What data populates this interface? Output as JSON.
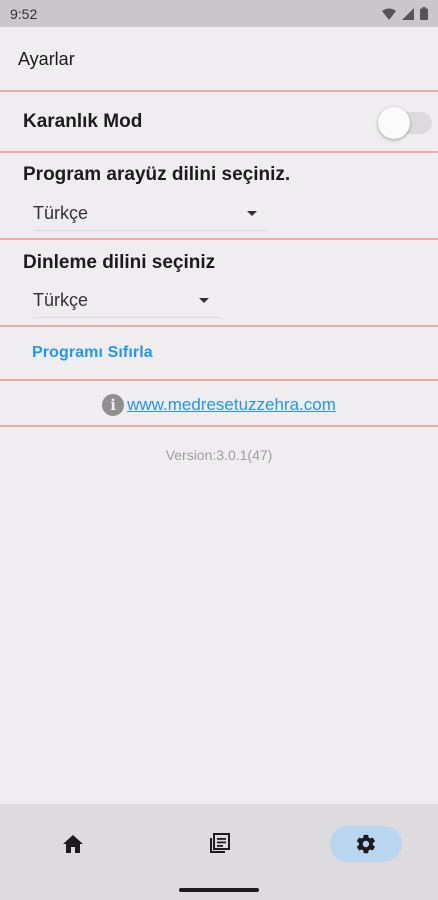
{
  "status_bar": {
    "time": "9:52"
  },
  "app_bar": {
    "title": "Ayarlar"
  },
  "dark_mode": {
    "label": "Karanlık Mod",
    "enabled": false
  },
  "ui_language": {
    "label": "Program arayüz dilini seçiniz.",
    "selected": "Türkçe"
  },
  "listen_language": {
    "label": "Dinleme dilini seçiniz",
    "selected": "Türkçe"
  },
  "reset": {
    "label": "Programı Sıfırla"
  },
  "website": {
    "url_text": "www.medresetuzzehra.com"
  },
  "version": {
    "text": "Version:3.0.1(47)"
  },
  "bottom_nav": {
    "items": [
      {
        "icon": "home-icon",
        "active": false
      },
      {
        "icon": "library-icon",
        "active": false
      },
      {
        "icon": "settings-icon",
        "active": true
      }
    ]
  },
  "colors": {
    "divider": "#f0a9a4",
    "link": "#2196f3",
    "active_nav": "#b9d5f0"
  }
}
